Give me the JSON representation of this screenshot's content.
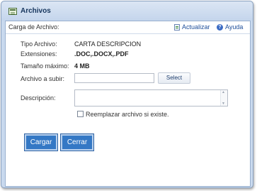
{
  "window": {
    "title": "Archivos",
    "icon": "window-list-icon"
  },
  "header": {
    "title": "Carga de Archivo:",
    "refresh_label": "Actualizar",
    "refresh_icon": "refresh-icon",
    "help_label": "Ayuda",
    "help_icon": "help-icon"
  },
  "fields": {
    "tipo_label": "Tipo Archivo:",
    "tipo_value": "CARTA DESCRIPCION",
    "ext_label": "Extensiones:",
    "ext_value": ".DOC,.DOCX,.PDF",
    "size_label": "Tamaño máximo:",
    "size_value": "4 MB",
    "upload_label": "Archivo a subir:",
    "upload_value": "",
    "select_label": "Select",
    "desc_label": "Descripción:",
    "desc_value": "",
    "replace_label": "Reemplazar archivo si existe.",
    "replace_checked": false
  },
  "buttons": {
    "cargar": "Cargar",
    "cerrar": "Cerrar"
  },
  "colors": {
    "accent": "#3478c5",
    "title_bar": "#c9d9ee",
    "link": "#1f4f9a"
  }
}
